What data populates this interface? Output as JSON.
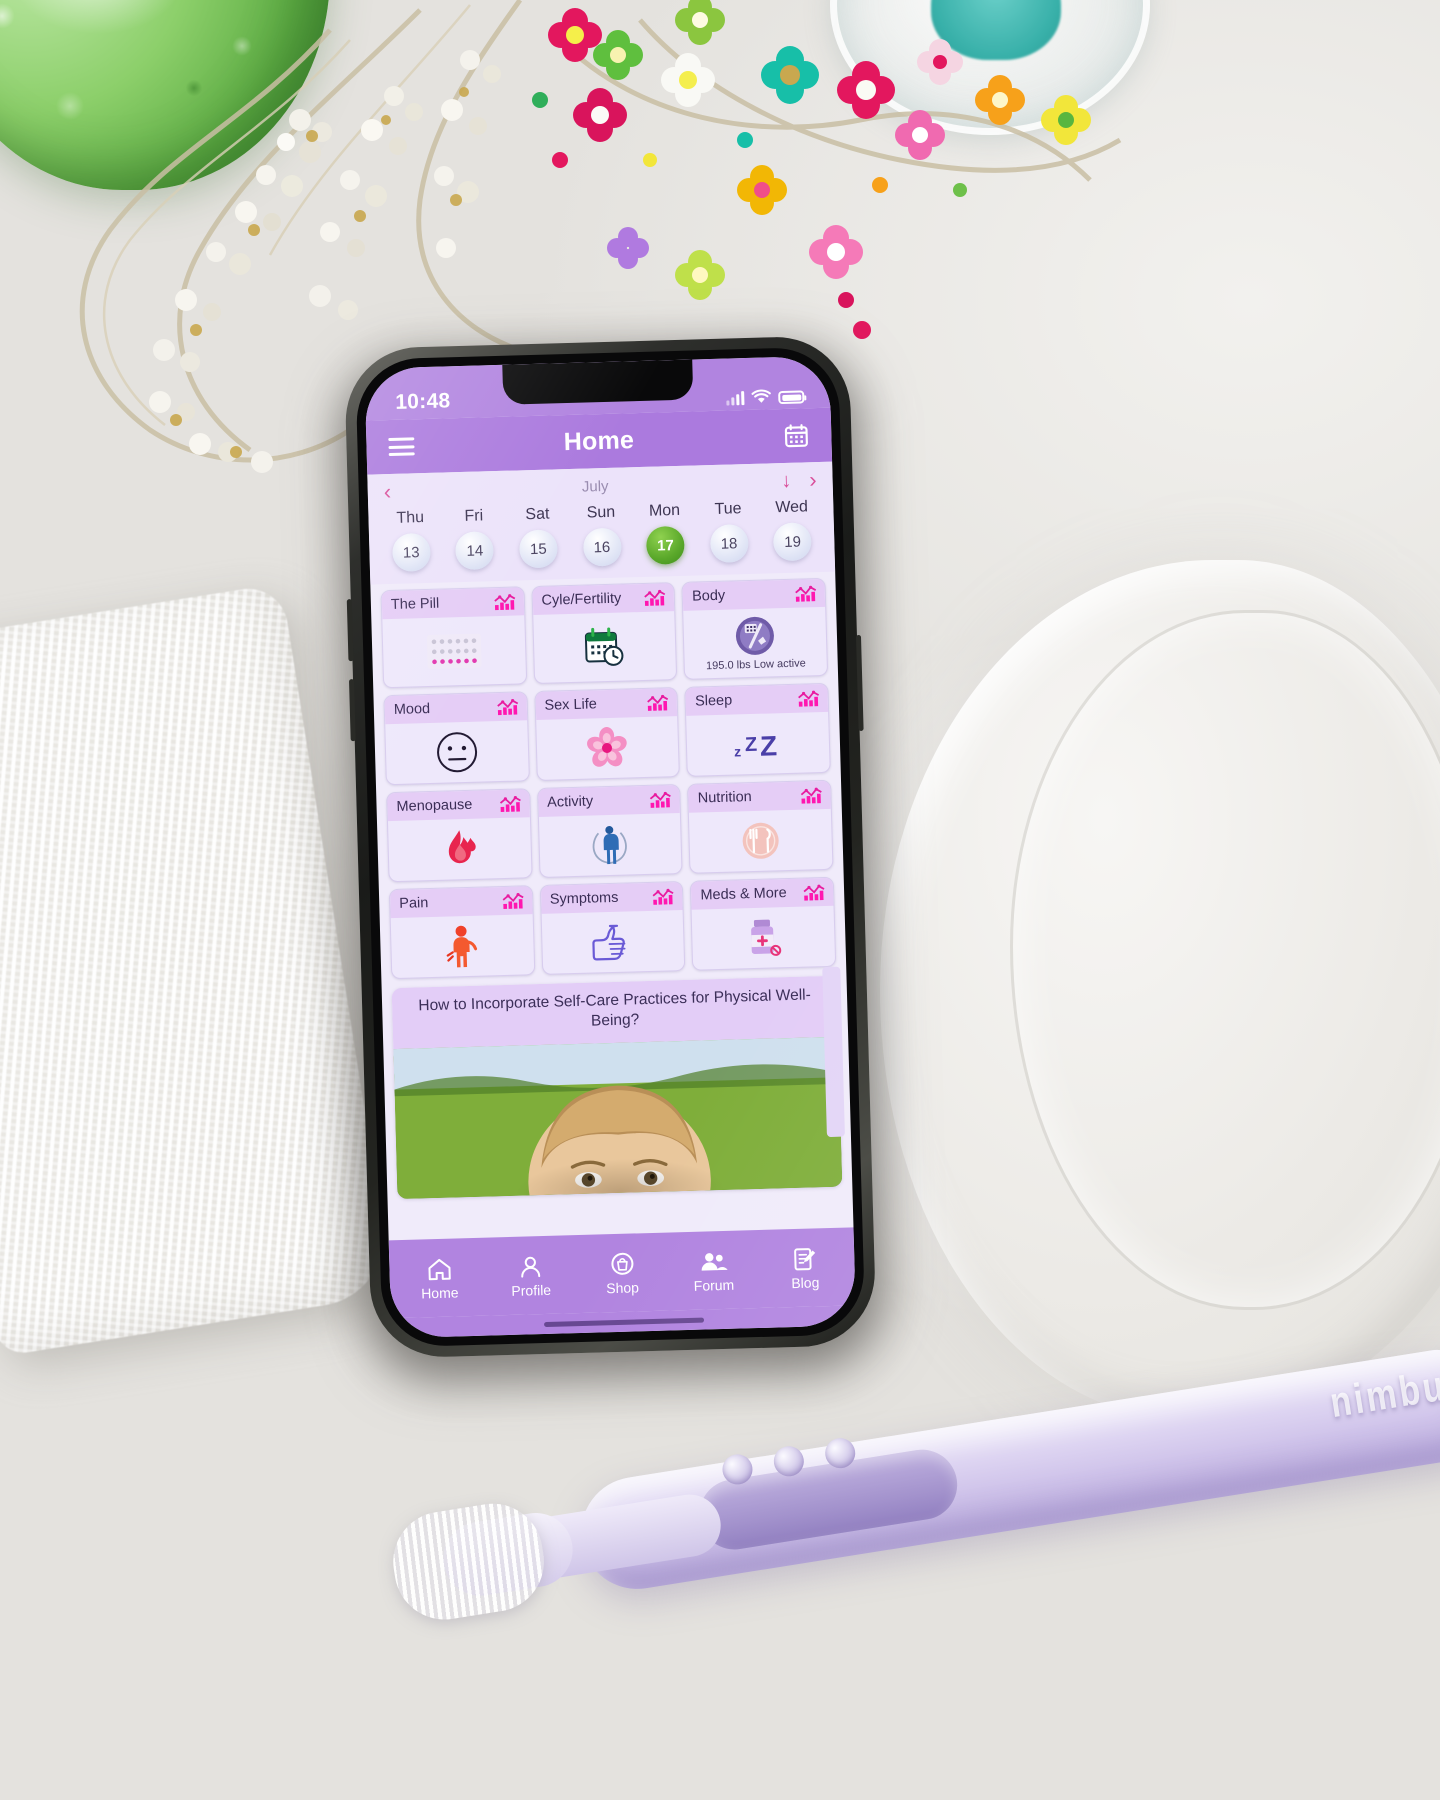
{
  "scene": {
    "description": "smartphone on a white bathroom counter with beaded flower necklace, folded white towel, green glass bowl and a lilac toothbrush",
    "toothbrush_brand": "nimbus"
  },
  "phone": {
    "status_bar": {
      "time": "10:48",
      "signal_icon": "cellular-signal-icon",
      "wifi_icon": "wifi-icon",
      "battery_icon": "battery-full-icon"
    },
    "app_bar": {
      "menu_icon": "hamburger-menu-icon",
      "title": "Home",
      "calendar_icon": "calendar-icon"
    },
    "calendar": {
      "prev_icon": "chevron-left-icon",
      "next_icon": "chevron-right-icon",
      "down_icon": "arrow-down-icon",
      "month": "July",
      "days": [
        {
          "name": "Thu",
          "date": "13",
          "selected": false
        },
        {
          "name": "Fri",
          "date": "14",
          "selected": false
        },
        {
          "name": "Sat",
          "date": "15",
          "selected": false
        },
        {
          "name": "Sun",
          "date": "16",
          "selected": false
        },
        {
          "name": "Mon",
          "date": "17",
          "selected": true
        },
        {
          "name": "Tue",
          "date": "18",
          "selected": false
        },
        {
          "name": "Wed",
          "date": "19",
          "selected": false
        }
      ]
    },
    "tracker_cards": [
      {
        "title": "The Pill",
        "icon": "pill-pack-icon",
        "chart_icon": "bar-chart-icon",
        "sub": ""
      },
      {
        "title": "Cyle/Fertility",
        "icon": "calendar-clock-icon",
        "chart_icon": "bar-chart-icon",
        "sub": ""
      },
      {
        "title": "Body",
        "icon": "body-scale-icon",
        "chart_icon": "bar-chart-icon",
        "sub": "195.0 lbs Low active"
      },
      {
        "title": "Mood",
        "icon": "neutral-face-icon",
        "chart_icon": "bar-chart-icon",
        "sub": ""
      },
      {
        "title": "Sex Life",
        "icon": "cherry-blossom-icon",
        "chart_icon": "bar-chart-icon",
        "sub": ""
      },
      {
        "title": "Sleep",
        "icon": "sleep-zzz-icon",
        "chart_icon": "bar-chart-icon",
        "sub": ""
      },
      {
        "title": "Menopause",
        "icon": "flame-icon",
        "chart_icon": "bar-chart-icon",
        "sub": ""
      },
      {
        "title": "Activity",
        "icon": "jump-rope-icon",
        "chart_icon": "bar-chart-icon",
        "sub": ""
      },
      {
        "title": "Nutrition",
        "icon": "fork-knife-plate-icon",
        "chart_icon": "bar-chart-icon",
        "sub": ""
      },
      {
        "title": "Pain",
        "icon": "person-pain-icon",
        "chart_icon": "bar-chart-icon",
        "sub": ""
      },
      {
        "title": "Symptoms",
        "icon": "thumbs-up-icon",
        "chart_icon": "bar-chart-icon",
        "sub": ""
      },
      {
        "title": "Meds & More",
        "icon": "medicine-bottle-icon",
        "chart_icon": "bar-chart-icon",
        "sub": ""
      }
    ],
    "article": {
      "title": "How to Incorporate Self-Care Practices for Physical Well-Being?",
      "image_alt": "woman outdoors on green grass"
    },
    "tab_bar": [
      {
        "label": "Home",
        "icon": "house-icon",
        "active": true
      },
      {
        "label": "Profile",
        "icon": "person-icon",
        "active": false
      },
      {
        "label": "Shop",
        "icon": "shop-bag-icon",
        "active": false
      },
      {
        "label": "Forum",
        "icon": "people-icon",
        "active": false
      },
      {
        "label": "Blog",
        "icon": "note-pen-icon",
        "active": false
      }
    ]
  },
  "colors": {
    "app_bar": "#ab7ade",
    "status_bar": "#b184e0",
    "calendar_bg": "#ece3fa",
    "card_header": "#e5cdf6",
    "card_body": "#eee8fb",
    "today_green": "#5aa82a",
    "accent_pink": "#e81ca0",
    "chevron_pink": "#d94f9a",
    "text_dark": "#3a2d55"
  }
}
